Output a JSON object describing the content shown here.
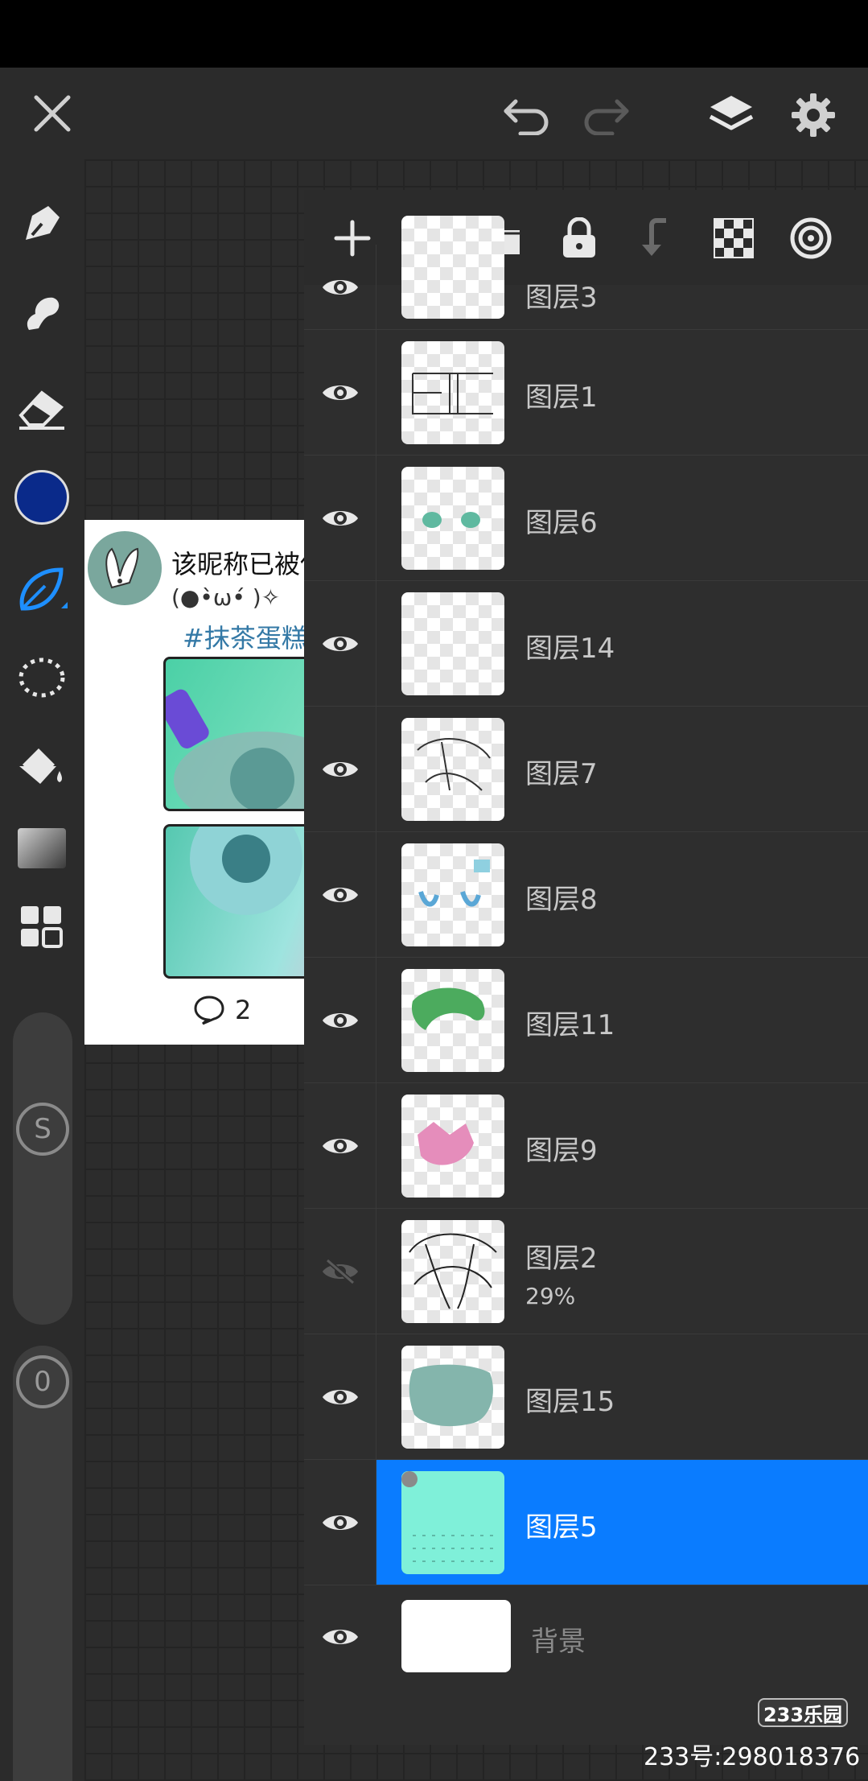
{
  "topbar": {
    "close_icon": "close-icon",
    "undo_icon": "undo-icon",
    "redo_icon": "redo-icon",
    "layers_icon": "layers-icon",
    "settings_icon": "gear-icon"
  },
  "colors": {
    "current_color": "#0a2a8a",
    "accent": "#0a7cff",
    "brush_active": "#1e8fff"
  },
  "tools": [
    "pen",
    "smudge",
    "eraser",
    "color",
    "brush",
    "lasso",
    "fill",
    "gradient",
    "grid"
  ],
  "sliders": {
    "size_label": "S",
    "opacity_label": "0"
  },
  "artwork": {
    "title": "该昵称已被使用",
    "subtitle": "(●•̀ω•́ )✧",
    "tag": "#抹茶蛋糕",
    "comment_count": "2"
  },
  "layers": [
    {
      "name": "图层3",
      "visible": true,
      "thumb": "text"
    },
    {
      "name": "图层1",
      "visible": true,
      "thumb": "frame"
    },
    {
      "name": "图层6",
      "visible": true,
      "thumb": "eyes"
    },
    {
      "name": "图层14",
      "visible": true,
      "thumb": "blank"
    },
    {
      "name": "图层7",
      "visible": true,
      "thumb": "sketch"
    },
    {
      "name": "图层8",
      "visible": true,
      "thumb": "blue"
    },
    {
      "name": "图层11",
      "visible": true,
      "thumb": "green"
    },
    {
      "name": "图层9",
      "visible": true,
      "thumb": "pink"
    },
    {
      "name": "图层2",
      "visible": false,
      "opacity": "29%",
      "thumb": "lineart"
    },
    {
      "name": "图层15",
      "visible": true,
      "thumb": "teal"
    },
    {
      "name": "图层5",
      "visible": true,
      "active": true,
      "thumb": "mint"
    },
    {
      "name": "背景",
      "visible": true,
      "thumb": "white"
    }
  ],
  "watermark": {
    "logo": "233乐园",
    "id": "233号:298018376"
  }
}
